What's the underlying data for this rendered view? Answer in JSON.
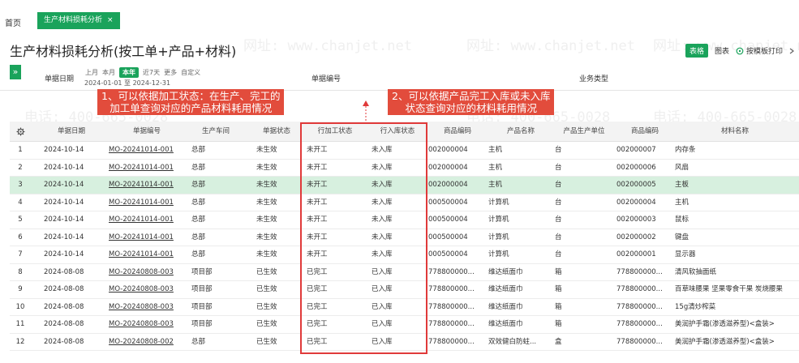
{
  "tabs": {
    "home": "首页",
    "active": "生产材料损耗分析",
    "close_icon": "×"
  },
  "page": {
    "title": "生产材料损耗分析(按工单+产品+材料)"
  },
  "toolbar": {
    "table_label": "表格",
    "chart_label": "图表",
    "print_label": "按模板打印",
    "print_icon": "printer-icon",
    "more_icon": "chevron-icon"
  },
  "filters": {
    "toggle_glyph": "»",
    "date_label": "单据日期",
    "presets": [
      "上月",
      "本月",
      "本年",
      "近7天",
      "更多",
      "自定义"
    ],
    "active_preset": "本年",
    "date_range": "2024-01-01 至 2024-12-31",
    "doc_no_label": "单据编号",
    "biz_type_label": "业务类型"
  },
  "annotations": {
    "left": [
      "1、可以依据加工状态：在生产、完工的",
      "加工单查询对应的产品材料耗用情况"
    ],
    "right": [
      "2、可以依据产品完工入库或未入库",
      "状态查询对应的材料耗用情况"
    ]
  },
  "watermark": {
    "phone": "电话: 400-665-0028",
    "site": "网址: www.chanjet.net"
  },
  "table": {
    "settings_icon": "gear-icon",
    "columns": [
      "单据日期",
      "单据编号",
      "生产车间",
      "单据状态",
      "行加工状态",
      "行入库状态",
      "商品编码",
      "产品名称",
      "产品生产单位",
      "商品编码",
      "材料名称"
    ],
    "rows": [
      [
        "1",
        "2024-10-14",
        "MO-20241014-001",
        "总部",
        "未生效",
        "未开工",
        "未入库",
        "002000004",
        "主机",
        "台",
        "002000007",
        "内存条"
      ],
      [
        "2",
        "2024-10-14",
        "MO-20241014-001",
        "总部",
        "未生效",
        "未开工",
        "未入库",
        "002000004",
        "主机",
        "台",
        "002000006",
        "风扇"
      ],
      [
        "3",
        "2024-10-14",
        "MO-20241014-001",
        "总部",
        "未生效",
        "未开工",
        "未入库",
        "002000004",
        "主机",
        "台",
        "002000005",
        "主板"
      ],
      [
        "4",
        "2024-10-14",
        "MO-20241014-001",
        "总部",
        "未生效",
        "未开工",
        "未入库",
        "000500004",
        "计算机",
        "台",
        "002000004",
        "主机"
      ],
      [
        "5",
        "2024-10-14",
        "MO-20241014-001",
        "总部",
        "未生效",
        "未开工",
        "未入库",
        "000500004",
        "计算机",
        "台",
        "002000003",
        "鼠标"
      ],
      [
        "6",
        "2024-10-14",
        "MO-20241014-001",
        "总部",
        "未生效",
        "未开工",
        "未入库",
        "000500004",
        "计算机",
        "台",
        "002000002",
        "键盘"
      ],
      [
        "7",
        "2024-10-14",
        "MO-20241014-001",
        "总部",
        "未生效",
        "未开工",
        "未入库",
        "000500004",
        "计算机",
        "台",
        "002000001",
        "显示器"
      ],
      [
        "8",
        "2024-08-08",
        "MO-20240808-003",
        "项目部",
        "已生效",
        "已完工",
        "已入库",
        "778800000...",
        "维达纸面巾",
        "箱",
        "778800000...",
        "清风软抽面纸"
      ],
      [
        "9",
        "2024-08-08",
        "MO-20240808-003",
        "项目部",
        "已生效",
        "已完工",
        "已入库",
        "778800000...",
        "维达纸面巾",
        "箱",
        "778800000...",
        "百草味腰果 坚果零食干果 炭烧腰果"
      ],
      [
        "10",
        "2024-08-08",
        "MO-20240808-003",
        "项目部",
        "已生效",
        "已完工",
        "已入库",
        "778800000...",
        "维达纸面巾",
        "箱",
        "778800000...",
        "15g清炒榨菜"
      ],
      [
        "11",
        "2024-08-08",
        "MO-20240808-003",
        "项目部",
        "已生效",
        "已完工",
        "已入库",
        "778800000...",
        "维达纸面巾",
        "箱",
        "778800000...",
        "美润护手霜(渗透滋养型)<盒装>"
      ],
      [
        "12",
        "2024-08-08",
        "MO-20240808-002",
        "总部",
        "已生效",
        "已完工",
        "已入库",
        "778800000...",
        "双效健白防蛀...",
        "盒",
        "778800000...",
        "美润护手霜(渗透滋养型)<盒装>"
      ]
    ],
    "highlight_row": 2
  }
}
